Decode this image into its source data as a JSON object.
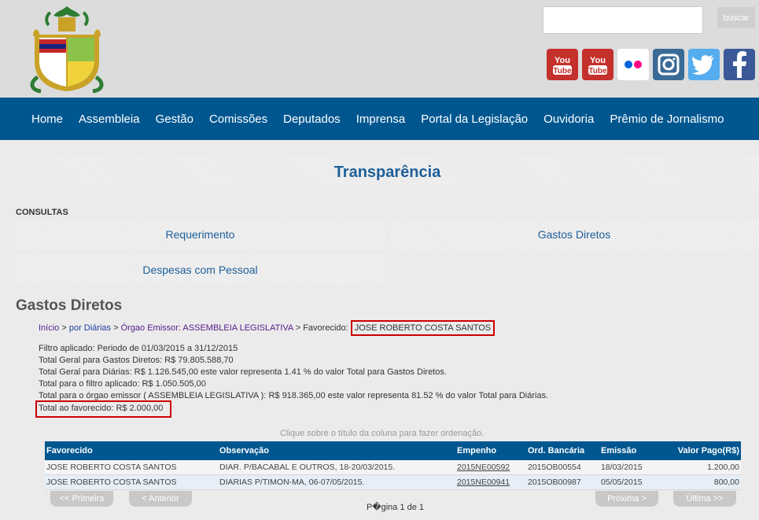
{
  "search": {
    "placeholder": "",
    "button": "buscar"
  },
  "social": {
    "youtube1": "You Tube",
    "youtube2": "You Tube",
    "icons": [
      "youtube-icon",
      "youtube-icon",
      "flickr-icon",
      "instagram-icon",
      "twitter-icon",
      "facebook-icon"
    ]
  },
  "nav": [
    "Home",
    "Assembleia",
    "Gestão",
    "Comissões",
    "Deputados",
    "Imprensa",
    "Portal da Legislação",
    "Ouvidoria",
    "Prêmio de Jornalismo"
  ],
  "page_title": "Transparência",
  "consultas": {
    "heading": "CONSULTAS",
    "requerimento": "Requerimento",
    "gastos": "Gastos Diretos",
    "despesas": "Despesas com Pessoal"
  },
  "section_title": "Gastos Diretos",
  "breadcrumb": {
    "inicio": "Início",
    "sep1": " > ",
    "diarias": "por Diárias",
    "sep2": " > ",
    "orgao": "Órgao Emissor: ASSEMBLEIA LEGISLATIVA",
    "sep3": " > ",
    "fav_label": "Favorecido: ",
    "fav_value": "JOSE ROBERTO COSTA SANTOS"
  },
  "info": {
    "filtro": "Filtro aplicado: Periodo de 01/03/2015 a 31/12/2015",
    "total_gastos": "Total Geral para Gastos Diretos: R$ 79.805.588,70",
    "total_diarias": "Total Geral para Diárias: R$ 1.126.545,00 este valor representa 1.41 % do valor Total para Gastos Diretos.",
    "total_filtro": "Total para o filtro aplicado: R$ 1.050.505,00",
    "total_orgao": "Total para o órgao emissor ( ASSEMBLEIA LEGISLATIVA ): R$ 918.365,00 este valor representa 81.52 % do valor Total para Diárias.",
    "total_fav": "Total ao favorecido: R$ 2.000,00"
  },
  "hint": "Clique sobre o título da coluna para fazer ordenação.",
  "table": {
    "headers": [
      "Favorecido",
      "Observação",
      "Empenho",
      "Ord. Bancária",
      "Emissão",
      "Valor Pago(R$)"
    ],
    "rows": [
      [
        "JOSE ROBERTO COSTA SANTOS",
        "DIAR. P/BACABAL E OUTROS, 18-20/03/2015.",
        "2015NE00592",
        "2015OB00554",
        "18/03/2015",
        "1.200,00"
      ],
      [
        "JOSE ROBERTO COSTA SANTOS",
        "DIARIAS P/TIMON-MA, 06-07/05/2015.",
        "2015NE00941",
        "2015OB00987",
        "05/05/2015",
        "800,00"
      ]
    ]
  },
  "pager": {
    "first": "<< Primeira",
    "prev": "< Anterior",
    "next": "Próxima >",
    "last": "Última >>",
    "info": "P�gina 1 de 1"
  },
  "colors": {
    "nav": "#005790",
    "title": "#1d5f99",
    "highlight": "#cc0000"
  }
}
